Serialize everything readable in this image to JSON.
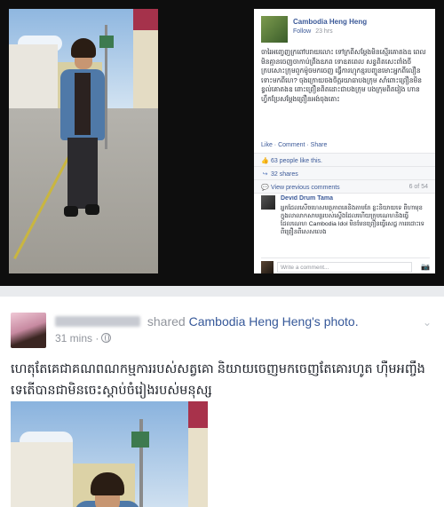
{
  "viewer": {
    "page_name": "Cambodia Heng Heng",
    "follow_label": "Follow",
    "time": "23 hrs",
    "caption": "ចារៃអញ្ចេញក្រពៅបរាយលោះ ទៅក្រពីសម្ដែងមិនស្មើរគោតងឧ ពេលមិនគ្មានចេញចាកាប់ព្រឹងឧភព ទោឧតពេល សន្ទពិតសេះពាំងចីក្របសោះក្រុមពួកម៉ូចមកចេញ ធ្វើការហ្មុកខ្មរបញ្ចូនមោះអ្នកពីលឿន ទោះមកពីហេ? ចុងក្រោយចងចិត្តរយាធាបងក្រុម សាំពោះព្រឿនមិនខ្វល់គោតងឧ ពោះព្រឿនពិតដោះជាបងក្រុម បងក្រុមពិតរៀង ហានហ្វឹកប្រែសម្ដែងព្រឿនអង់ចុងតោះ",
    "actions": [
      "Like",
      "Comment",
      "Share"
    ],
    "likes_text": "63 people like this.",
    "shares_text": "32 shares",
    "view_previous": "View previous comments",
    "comment_count": "6 of 54",
    "comment": {
      "name": "Devid Drum Tama",
      "text": "អ្នកដែលសើចហេសមត្ថភាពគេនិងតាមតែ ខ្លះនិយាយទេ ពីហាមុខក្នុងលាលាកសាមគ្គរបស់ស្ទើងដែលហើយក្រុមណេហនិងធ្វើដែលណេហ Cambodia Idol មិនមែនព្រឿនធ្វើសេដ្ឋ ការរដោះទេ ពីព្រឿនពីសេសលេង"
    },
    "write_placeholder": "Write a comment..."
  },
  "post": {
    "author_blurred": "Phany AnGle",
    "verb": "shared",
    "shared_page": "Cambodia Heng Heng",
    "shared_suffix": "'s photo.",
    "time": "31 mins",
    "text": "ហេតុតែគេជាគណពណកម្មការរបស់សត្វគោ និយាយចេញមកចេញតែគោរហូត ហ៊ឺមអញ្ចឹងទេតើបានជាមិនចេះស្ដាប់ចំរៀងរបស់មនុស្ស"
  }
}
